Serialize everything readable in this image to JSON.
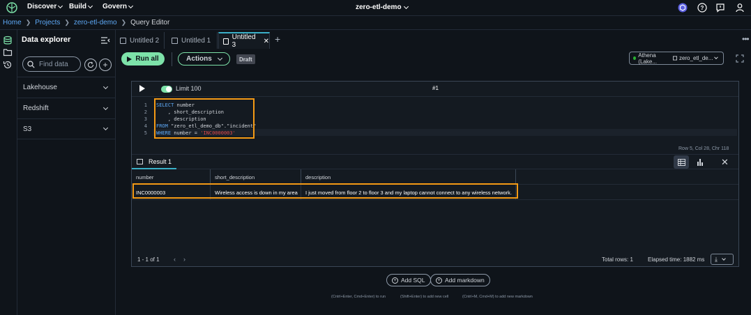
{
  "nav": {
    "menus": [
      "Discover",
      "Build",
      "Govern"
    ],
    "project_selector": "zero-etl-demo"
  },
  "breadcrumb": [
    "Home",
    "Projects",
    "zero-etl-demo",
    "Query Editor"
  ],
  "explorer": {
    "title": "Data explorer",
    "search_placeholder": "Find data",
    "sections": [
      "Lakehouse",
      "Redshift",
      "S3"
    ]
  },
  "tabs": [
    {
      "label": "Untitled 2",
      "active": false
    },
    {
      "label": "Untitled 1",
      "active": false
    },
    {
      "label": "Untitled 3",
      "active": true
    }
  ],
  "toolbar": {
    "run_all": "Run all",
    "actions": "Actions",
    "draft_badge": "Draft",
    "connection": "Athena (Lake...",
    "database": "zero_etl_de..."
  },
  "cell": {
    "limit_label": "Limit 100",
    "limit_enabled": true,
    "cell_number": "#1",
    "line_numbers": [
      "1",
      "2",
      "3",
      "4",
      "5"
    ],
    "code": {
      "l1_kw": "SELECT",
      "l1_rest": " number",
      "l2": "    , short_description",
      "l3": "    , description",
      "l4_kw": "FROM",
      "l4_rest": " \"zero_etl_demo_db\".\"incident\"",
      "l5_kw": "WHERE",
      "l5_rest": " number = ",
      "l5_str": "'INC0000003'"
    },
    "cursor_info": "Row 5, Col 28, Chr 118"
  },
  "results": {
    "tab_label": "Result 1",
    "columns": [
      "number",
      "short_description",
      "description"
    ],
    "rows": [
      [
        "INC0000003",
        "Wireless access is down in my area",
        "I just moved from floor 2 to floor 3 and my laptop cannot connect to any wireless network."
      ]
    ],
    "pagination": "1 - 1 of 1",
    "total_rows": "Total rows: 1",
    "elapsed": "Elapsed time: 1882 ms"
  },
  "bottom": {
    "add_sql": "Add SQL",
    "add_markdown": "Add markdown",
    "hints": [
      "(Cntrl+Enter, Cmd+Enter) to run",
      "(Shift+Enter) to add new cell",
      "(Cntrl+M, Cmd+M) to add new markdown"
    ]
  },
  "colors": {
    "accent_green": "#7de2a9",
    "highlight_orange": "#f49a15",
    "link_blue": "#5ea9f6",
    "tab_accent": "#3ab0c8"
  }
}
